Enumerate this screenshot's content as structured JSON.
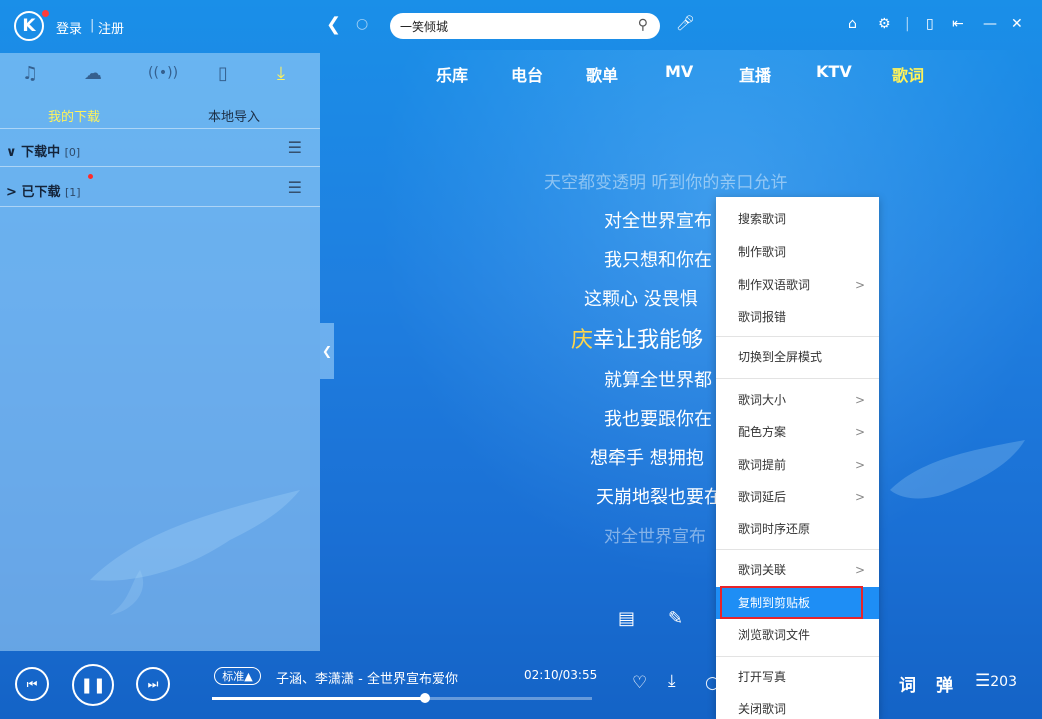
{
  "header": {
    "logo_letter": "K",
    "login": "登录",
    "separator": "|",
    "register": "注册",
    "search_value": "一笑倾城",
    "icons": [
      "back-icon",
      "refresh-icon",
      "search-icon",
      "voice-icon",
      "skin-icon",
      "settings-icon",
      "mini-mode-icon",
      "dock-icon",
      "minimize-icon",
      "close-icon"
    ]
  },
  "main_nav": [
    "乐库",
    "电台",
    "歌单",
    "MV",
    "直播",
    "KTV",
    "歌词"
  ],
  "left_panel": {
    "icons": [
      "music-icon",
      "cloud-icon",
      "radio-icon",
      "device-icon",
      "download-icon"
    ],
    "tabs": {
      "my_download": "我的下载",
      "local_import": "本地导入"
    },
    "rows": [
      {
        "arrow": "∨",
        "title": "下载中",
        "count": "[0]"
      },
      {
        "arrow": ">",
        "title": "已下载",
        "count": "[1]"
      }
    ]
  },
  "lyrics": {
    "lines": [
      "天空都变透明 听到你的亲口允许",
      "对全世界宣布",
      "我只想和你在",
      "这颗心 没畏惧",
      "幸让我能够",
      "就算全世界都",
      "我也要跟你在",
      "想牵手 想拥抱",
      "天崩地裂也要在",
      "对全世界宣布"
    ],
    "current_prefix": "庆"
  },
  "context_menu": {
    "items": [
      {
        "label": "搜索歌词",
        "submenu": false
      },
      {
        "label": "制作歌词",
        "submenu": false
      },
      {
        "label": "制作双语歌词",
        "submenu": true
      },
      {
        "label": "歌词报错",
        "submenu": false
      },
      {
        "label": "切换到全屏模式",
        "submenu": false
      },
      {
        "label": "歌词大小",
        "submenu": true
      },
      {
        "label": "配色方案",
        "submenu": true
      },
      {
        "label": "歌词提前",
        "submenu": true
      },
      {
        "label": "歌词延后",
        "submenu": true
      },
      {
        "label": "歌词时序还原",
        "submenu": false
      },
      {
        "label": "歌词关联",
        "submenu": true
      },
      {
        "label": "复制到剪贴板",
        "submenu": false,
        "highlighted": true
      },
      {
        "label": "浏览歌词文件",
        "submenu": false
      },
      {
        "label": "打开写真",
        "submenu": false
      },
      {
        "label": "关闭歌词",
        "submenu": false
      }
    ],
    "submenu_arrow": ">"
  },
  "player": {
    "quality": "标准▲",
    "song": "子涵、李潇潇 - 全世界宣布爱你",
    "time": "02:10/03:55",
    "progress": 0.56,
    "lyric_label": "词",
    "danmu_label": "弹",
    "playlist_count": "203",
    "icons": [
      "prev-icon",
      "pause-icon",
      "next-icon",
      "heart-icon",
      "download-icon",
      "mv-icon",
      "mic-icon",
      "playlist-icon"
    ]
  },
  "colors": {
    "accent": "#1e8ef5",
    "highlight_text": "#ffd64a",
    "tab_active": "#fff35a",
    "menu_highlight": "#1e8ef5",
    "red_box": "#e8242a"
  }
}
